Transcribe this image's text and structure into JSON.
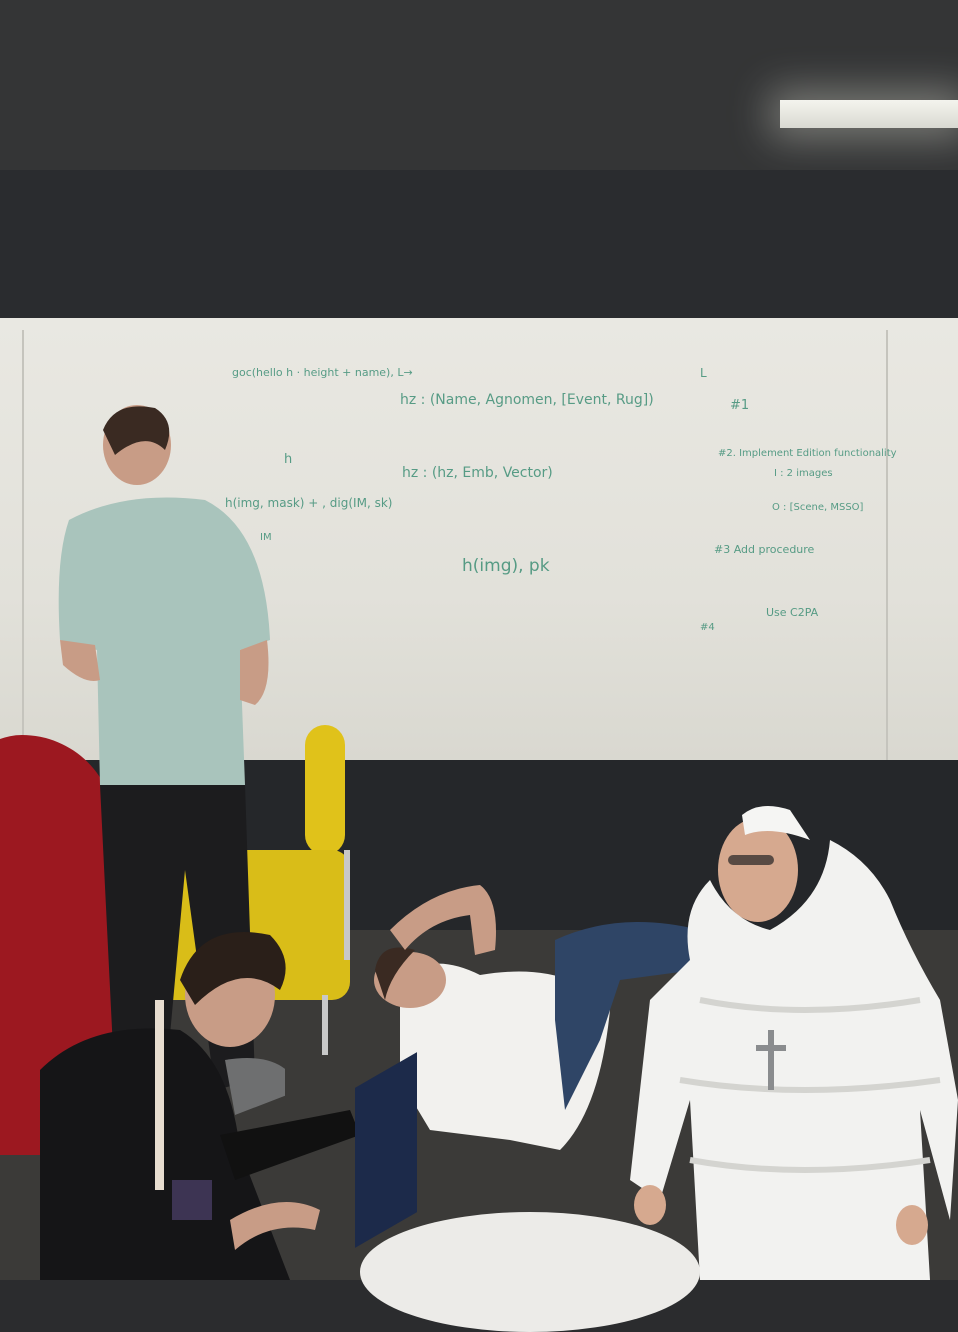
{
  "whiteboard": {
    "notes": [
      "goc(hello h · height + name), L→",
      "hz : (Name, Agnomen, [Event, Rug])",
      "h",
      "h(img, mask) + , dig(IM, sk)",
      "IM",
      "hz : (hz, Emb, Vector)",
      "h(img), pk",
      "L",
      "#1",
      "#2.  Implement Edition functionality",
      "I : 2 images",
      "O : [Scene, MSSO]",
      "#3  Add procedure",
      "#4",
      "Use C2PA"
    ]
  },
  "colors": {
    "wall": "#2a2c2f",
    "whiteboard": "#e6e5df",
    "marker": "#3e8f76",
    "yellow_chair": "#d9bd18",
    "red_chair": "#9c1820",
    "white_puffer_coat": "#f2f2f0"
  }
}
